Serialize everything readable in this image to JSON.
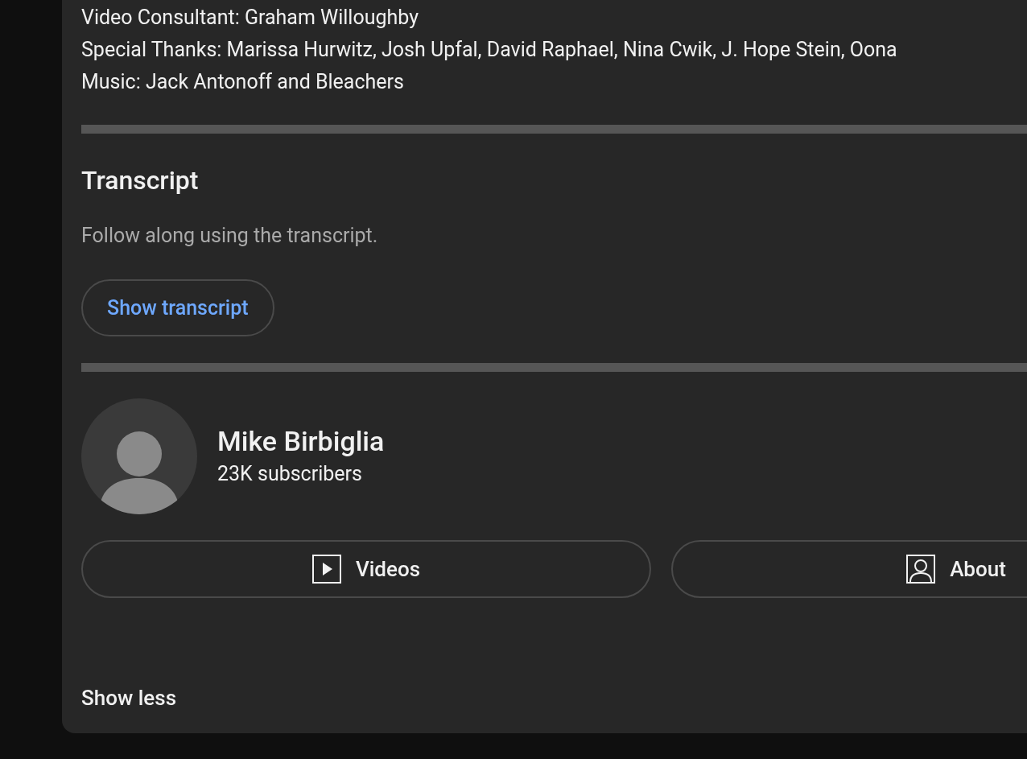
{
  "credits": [
    "Video Consultant: Graham Willoughby",
    "Special Thanks: Marissa Hurwitz, Josh Upfal, David Raphael, Nina Cwik, J. Hope Stein, Oona",
    "Music: Jack Antonoff and Bleachers"
  ],
  "transcript": {
    "title": "Transcript",
    "subtitle": "Follow along using the transcript.",
    "button": "Show transcript"
  },
  "channel": {
    "name": "Mike Birbiglia",
    "subscribers": "23K subscribers"
  },
  "channel_buttons": [
    {
      "kind": "videos",
      "label": "Videos"
    },
    {
      "kind": "about",
      "label": "About"
    }
  ],
  "show_less": "Show less"
}
